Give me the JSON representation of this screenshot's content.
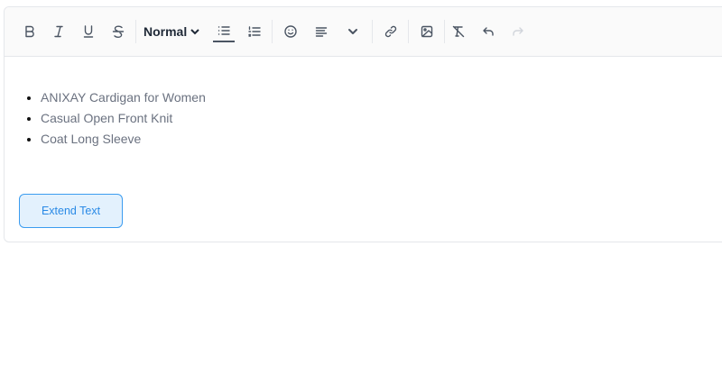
{
  "toolbar": {
    "heading_select": "Normal",
    "buttons": [
      "bold-icon",
      "italic-icon",
      "underline-icon",
      "strikethrough-icon",
      "bullet-list-icon",
      "ordered-list-icon",
      "emoji-icon",
      "align-left-icon",
      "chevron-down-icon",
      "link-icon",
      "image-icon",
      "clear-format-icon",
      "undo-icon",
      "redo-icon"
    ]
  },
  "content": {
    "items": [
      "ANIXAY Cardigan for Women",
      "Casual Open Front Knit",
      "Coat Long Sleeve"
    ]
  },
  "actions": {
    "extend_label": "Extend Text"
  },
  "colors": {
    "accent": "#2a8ae6",
    "button_bg": "#e3f1fd"
  }
}
